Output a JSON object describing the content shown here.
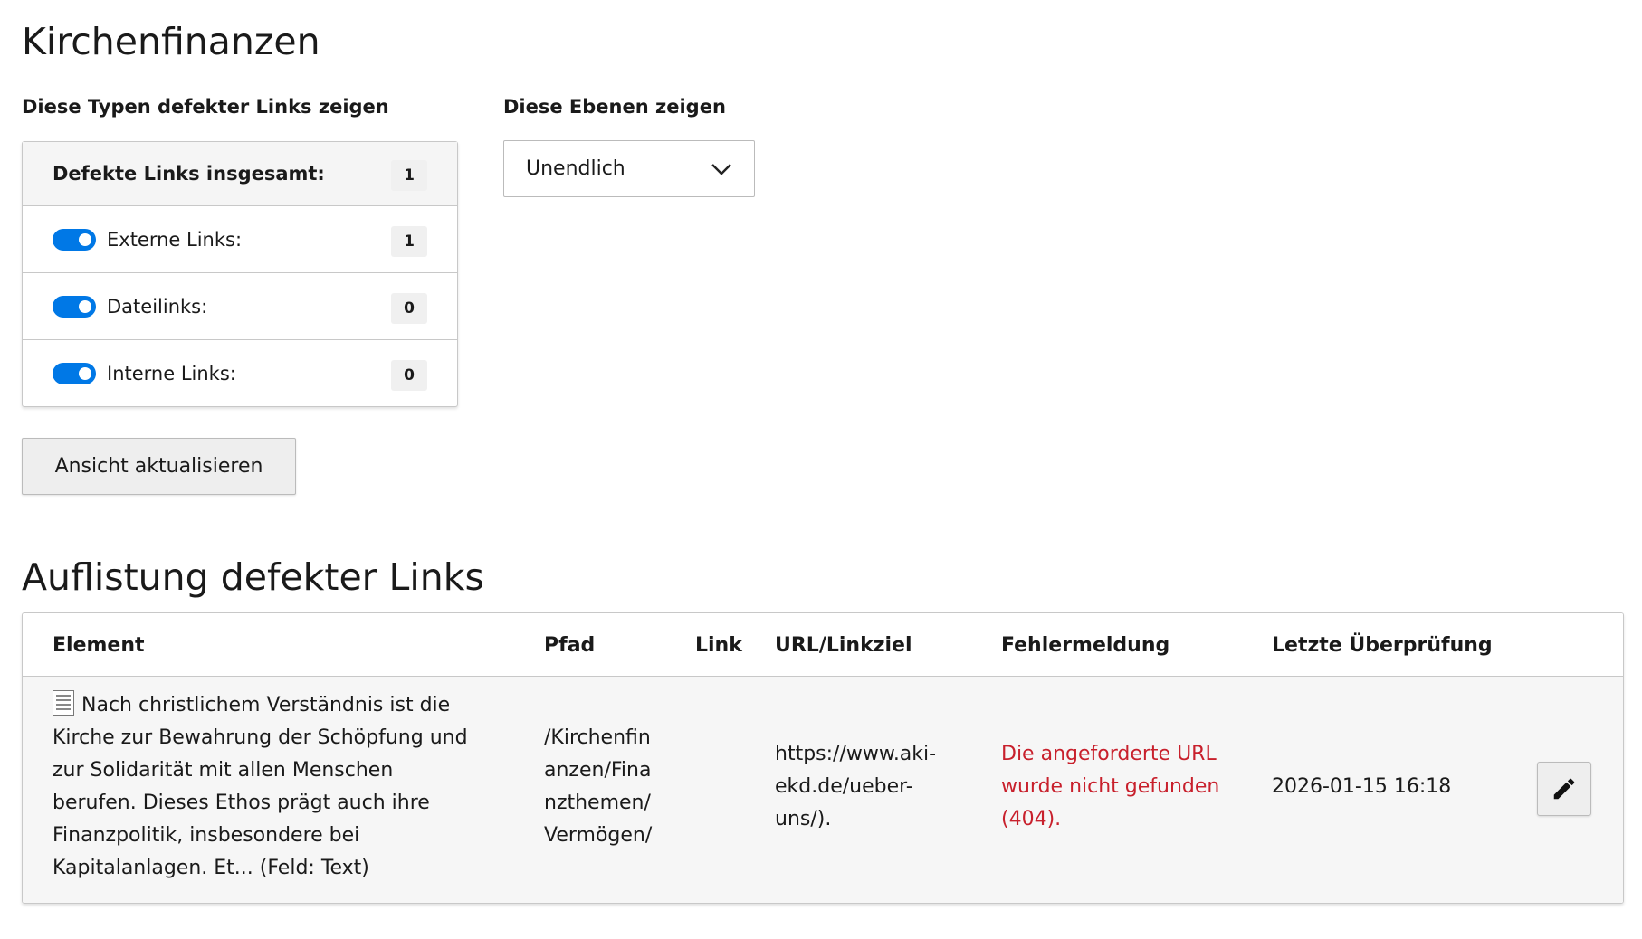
{
  "page": {
    "title": "Kirchenfinanzen"
  },
  "filters": {
    "types_heading": "Diese Typen defekter Links zeigen",
    "levels_heading": "Diese Ebenen zeigen",
    "total": {
      "label": "Defekte Links insgesamt:",
      "count": "1"
    },
    "types": [
      {
        "label": "Externe Links:",
        "count": "1",
        "enabled": true
      },
      {
        "label": "Dateilinks:",
        "count": "0",
        "enabled": true
      },
      {
        "label": "Interne Links:",
        "count": "0",
        "enabled": true
      }
    ],
    "level_select": {
      "value": "Unendlich"
    },
    "refresh_label": "Ansicht aktualisieren"
  },
  "results": {
    "heading": "Auflistung defekter Links",
    "columns": [
      "Element",
      "Pfad",
      "Link",
      "URL/Linkziel",
      "Fehlermeldung",
      "Letzte Überprüfung"
    ],
    "rows": [
      {
        "element_lines": [
          "Nach christlichem Verständnis ist die",
          "Kirche zur Bewahrung der Schöpfung und",
          "zur Solidarität mit allen Menschen",
          "berufen. Dieses Ethos prägt auch ihre",
          "Finanzpolitik, insbesondere bei",
          "Kapitalanlagen. Et... (Feld: Text)"
        ],
        "path_lines": [
          "/Kirchenfin",
          "anzen/Fina",
          "nzthemen/",
          "Vermögen/"
        ],
        "link": "",
        "url_lines": [
          "https://www.aki-",
          "ekd.de/ueber-",
          "uns/)."
        ],
        "error_lines": [
          "Die angeforderte URL",
          "wurde nicht gefunden",
          "(404)."
        ],
        "last_check": "2026-01-15 16:18",
        "icon": "content-element-icon",
        "action_icon": "pencil-icon"
      }
    ]
  },
  "colors": {
    "toggle_on": "#0078e6",
    "error": "#c8202c"
  }
}
